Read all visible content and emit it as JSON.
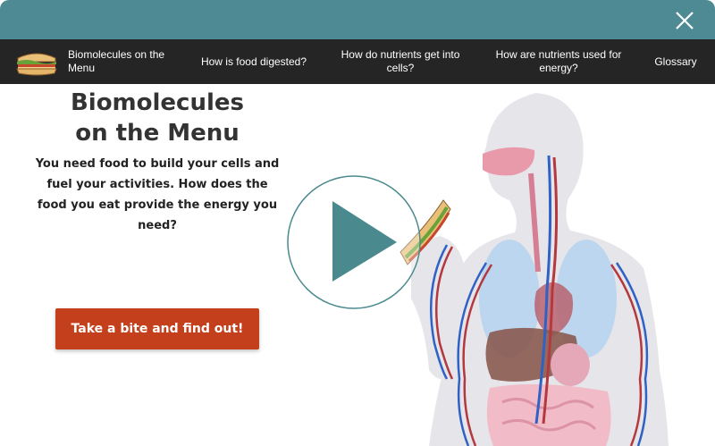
{
  "window": {
    "close_icon": "close-icon"
  },
  "nav": {
    "logo_icon": "sandwich-icon",
    "items": [
      {
        "label": "Biomolecules on the Menu"
      },
      {
        "label": "How is food digested?"
      },
      {
        "label": "How do nutrients get into cells?"
      },
      {
        "label": "How are nutrients used for energy?"
      },
      {
        "label": "Glossary"
      }
    ]
  },
  "hero": {
    "title": "Biomolecules on the Menu",
    "text": "You need food to build your cells and fuel your activities. How does the food you eat provide the energy you need?",
    "cta_label": "Take a bite and find out!",
    "play_icon": "play-icon"
  },
  "colors": {
    "topbar": "#4e8a93",
    "navbar": "#252525",
    "cta": "#c4401d",
    "play": "#4a8a8e"
  }
}
